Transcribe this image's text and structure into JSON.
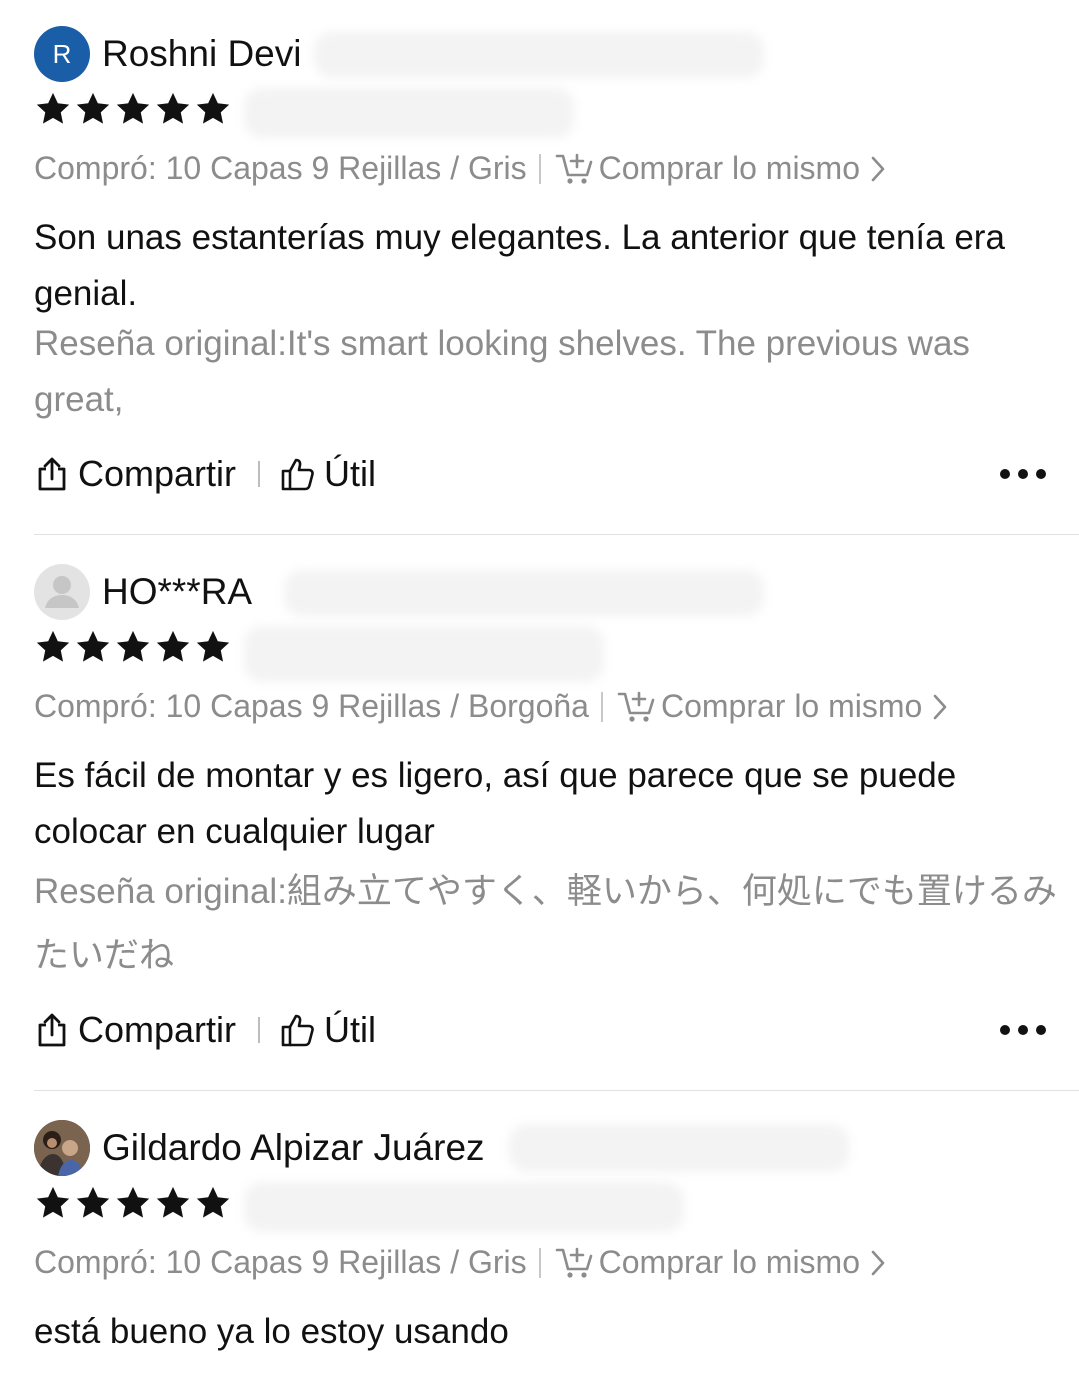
{
  "reviews": [
    {
      "avatar_letter": "R",
      "name": "Roshni Devi",
      "rating": 5,
      "purchase": "Compró: 10 Capas 9 Rejillas / Gris",
      "buy_same": "Comprar lo mismo",
      "text": "Son unas estanterías muy elegantes. La anterior que tenía era genial.",
      "original": "Reseña original:It's smart looking shelves. The previous was great,",
      "share": "Compartir",
      "helpful": "Útil"
    },
    {
      "avatar_letter": "",
      "name": "HO***RA",
      "rating": 5,
      "purchase": "Compró: 10 Capas 9 Rejillas / Borgoña",
      "buy_same": "Comprar lo mismo",
      "text": "Es fácil de montar y es ligero, así que parece que se puede colocar en cualquier lugar",
      "original": "Reseña original:組み立てやすく、軽いから、何処にでも置けるみたいだね",
      "share": "Compartir",
      "helpful": "Útil"
    },
    {
      "avatar_letter": "",
      "name": "Gildardo Alpizar Juárez",
      "rating": 5,
      "purchase": "Compró: 10 Capas 9 Rejillas / Gris",
      "buy_same": "Comprar lo mismo",
      "text": "está bueno ya lo estoy usando"
    }
  ],
  "colors": {
    "avatar_blue": "#1a5ea8",
    "muted_text": "#8c8c8c",
    "primary_text": "#111111",
    "divider": "#e2e2e2"
  },
  "icons": [
    "star-icon",
    "cart-plus-icon",
    "chevron-right-icon",
    "share-icon",
    "thumbs-up-icon",
    "more-dots-icon"
  ]
}
